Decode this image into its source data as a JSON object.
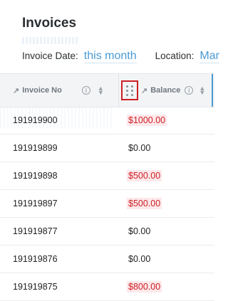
{
  "page": {
    "title": "Invoices"
  },
  "filters": {
    "invoice_date_label": "Invoice Date:",
    "invoice_date_value": "this month",
    "location_label": "Location:",
    "location_value": "Mar"
  },
  "table": {
    "columns": [
      {
        "label": "Invoice No",
        "icon": "trend-icon"
      },
      {
        "label": "Balance",
        "icon": "trend-icon"
      }
    ],
    "rows": [
      {
        "invoice_no": "191919900",
        "balance": "$1000.00",
        "highlight": true
      },
      {
        "invoice_no": "191919899",
        "balance": "$0.00",
        "highlight": false
      },
      {
        "invoice_no": "191919898",
        "balance": "$500.00",
        "highlight": true
      },
      {
        "invoice_no": "191919897",
        "balance": "$500.00",
        "highlight": true
      },
      {
        "invoice_no": "191919877",
        "balance": "$0.00",
        "highlight": false
      },
      {
        "invoice_no": "191919876",
        "balance": "$0.00",
        "highlight": false
      },
      {
        "invoice_no": "191919875",
        "balance": "$800.00",
        "highlight": true
      }
    ]
  },
  "colors": {
    "accent": "#4a9ad4",
    "negative": "#cc1f24",
    "header_bg": "#f3f4f6"
  }
}
